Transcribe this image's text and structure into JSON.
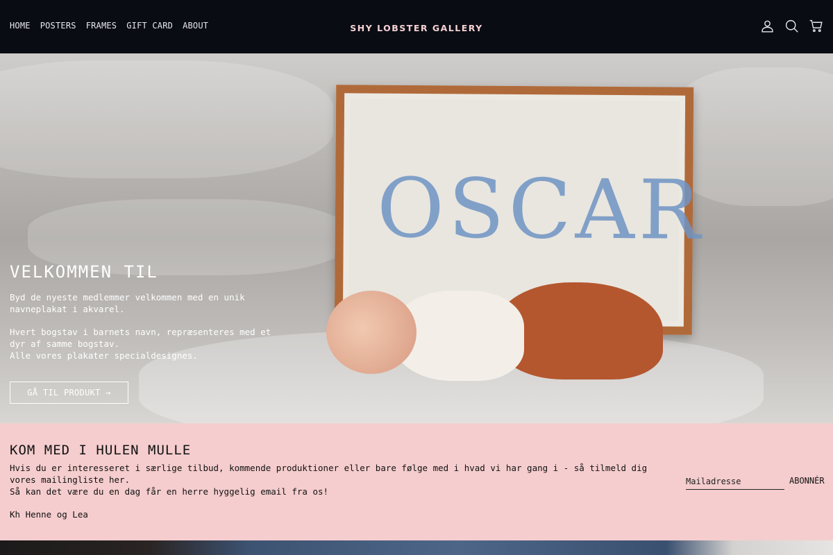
{
  "header": {
    "nav": [
      {
        "label": "HOME"
      },
      {
        "label": "POSTERS"
      },
      {
        "label": "FRAMES"
      },
      {
        "label": "GIFT CARD"
      },
      {
        "label": "ABOUT"
      }
    ],
    "logo": "SHY LOBSTER GALLERY",
    "icons": [
      "user-icon",
      "search-icon",
      "cart-icon"
    ]
  },
  "hero": {
    "poster_text": "OSCAR",
    "title": "VELKOMMEN TIL",
    "p1": "Byd de nyeste medlemmer velkommen med en unik navneplakat i akvarel.",
    "p2": "Hvert bogstav i barnets navn, repræsenteres med et dyr af samme bogstav.\nAlle vores plakater specialdesignes.",
    "cta": "GÅ TIL PRODUKT →"
  },
  "newsletter": {
    "title": "KOM MED I HULEN MULLE",
    "body": "Hvis du er interesseret i særlige tilbud, kommende produktioner eller bare følge med i hvad vi har gang i - så tilmeld dig vores mailingliste her.\nSå kan det være du en dag får en herre hyggelig email fra os!",
    "sign": "Kh Henne og Lea",
    "email_placeholder": "Mailadresse",
    "subscribe": "ABONNÉR"
  },
  "colors": {
    "header_bg": "#0a0c14",
    "logo": "#f6d2d3",
    "newsletter_bg": "#f5cdce",
    "frame": "#b06a3a"
  }
}
